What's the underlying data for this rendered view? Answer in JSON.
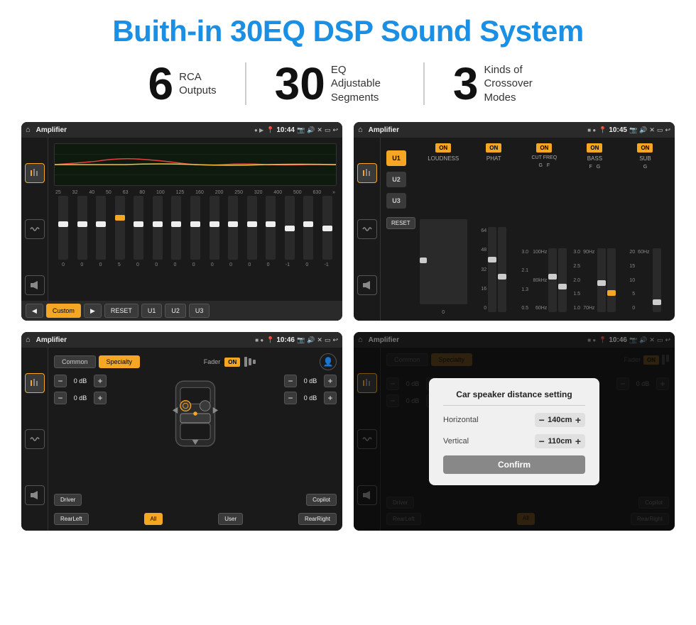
{
  "title": "Buith-in 30EQ DSP Sound System",
  "stats": [
    {
      "number": "6",
      "text": "RCA\nOutputs"
    },
    {
      "number": "30",
      "text": "EQ Adjustable\nSegments"
    },
    {
      "number": "3",
      "text": "Kinds of\nCrossover Modes"
    }
  ],
  "screens": [
    {
      "id": "screen1",
      "title": "Amplifier",
      "time": "10:44",
      "type": "eq",
      "frequencies": [
        "25",
        "32",
        "40",
        "50",
        "63",
        "80",
        "100",
        "125",
        "160",
        "200",
        "250",
        "320",
        "400",
        "500",
        "630"
      ],
      "values": [
        "0",
        "0",
        "0",
        "5",
        "0",
        "0",
        "0",
        "0",
        "0",
        "0",
        "0",
        "0",
        "-1",
        "0",
        "-1"
      ],
      "preset": "Custom",
      "buttons": [
        "◀",
        "Custom",
        "▶",
        "RESET",
        "U1",
        "U2",
        "U3"
      ]
    },
    {
      "id": "screen2",
      "title": "Amplifier",
      "time": "10:45",
      "type": "crossover",
      "uButtons": [
        "U1",
        "U2",
        "U3"
      ],
      "channels": [
        "LOUDNESS",
        "PHAT",
        "CUT FREQ",
        "BASS",
        "SUB"
      ],
      "resetLabel": "RESET"
    },
    {
      "id": "screen3",
      "title": "Amplifier",
      "time": "10:46",
      "type": "specialty",
      "tabs": [
        "Common",
        "Specialty"
      ],
      "faderLabel": "Fader",
      "faderOn": "ON",
      "dbValues": [
        "0 dB",
        "0 dB",
        "0 dB",
        "0 dB"
      ],
      "bottomLabels": [
        "Driver",
        "",
        "Copilot",
        "RearLeft",
        "All",
        "User",
        "RearRight"
      ]
    },
    {
      "id": "screen4",
      "title": "Amplifier",
      "time": "10:46",
      "type": "distance",
      "tabs": [
        "Common",
        "Specialty"
      ],
      "dialogTitle": "Car speaker distance setting",
      "horizontal": {
        "label": "Horizontal",
        "value": "140cm"
      },
      "vertical": {
        "label": "Vertical",
        "value": "110cm"
      },
      "confirmLabel": "Confirm",
      "bottomLabels": [
        "Driver",
        "",
        "Copilot",
        "RearLeft",
        "All",
        "User",
        "RearRight"
      ]
    }
  ],
  "colors": {
    "accent": "#f5a623",
    "blue": "#1a8fe3",
    "dark": "#1a1a1a",
    "text": "#ffffff"
  }
}
